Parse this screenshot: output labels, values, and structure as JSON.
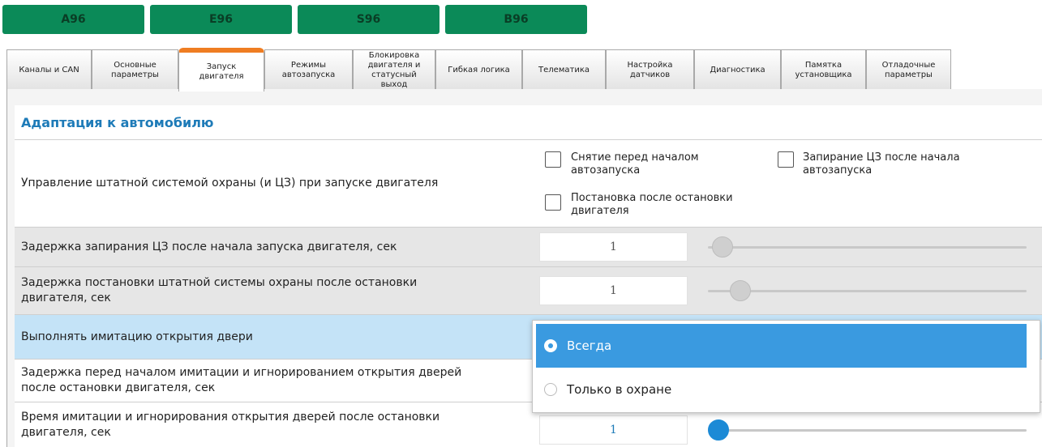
{
  "models": [
    "A96",
    "E96",
    "S96",
    "B96"
  ],
  "tabs": [
    {
      "label": "Каналы и CAN",
      "active": false
    },
    {
      "label": "Основные\nпараметры",
      "active": false
    },
    {
      "label": "Запуск\nдвигателя",
      "active": true
    },
    {
      "label": "Режимы\nавтозапуска",
      "active": false
    },
    {
      "label": "Блокировка\nдвигателя и\nстатусный\nвыход",
      "active": false
    },
    {
      "label": "Гибкая логика",
      "active": false
    },
    {
      "label": "Телематика",
      "active": false
    },
    {
      "label": "Настройка\nдатчиков",
      "active": false
    },
    {
      "label": "Диагностика",
      "active": false
    },
    {
      "label": "Памятка\nустановщика",
      "active": false
    },
    {
      "label": "Отладочные\nпараметры",
      "active": false
    }
  ],
  "section": {
    "title": "Адаптация к автомобилю"
  },
  "rows": {
    "alarm_control": {
      "label": "Управление штатной системой охраны (и ЦЗ) при запуске двигателя",
      "checkbox_disarm": "Снятие перед началом\nавтозапуска",
      "checkbox_lock": "Запирание ЦЗ после начала\nавтозапуска",
      "checkbox_arm": "Постановка после остановки\nдвигателя"
    },
    "lock_delay": {
      "label": "Задержка запирания ЦЗ после начала запуска двигателя, сек",
      "value": "1",
      "slider_value": 1
    },
    "arm_delay": {
      "label": "Задержка постановки штатной системы охраны после остановки\nдвигателя, сек",
      "value": "1",
      "slider_value": 1
    },
    "door_imitation": {
      "label": "Выполнять имитацию открытия двери"
    },
    "imitation_delay": {
      "label": "Задержка перед началом имитации и игнорированием открытия дверей\nпосле остановки двигателя, сек"
    },
    "imitation_time": {
      "label": "Время имитации и игнорирования открытия дверей после остановки\nдвигателя, сек",
      "value": "1",
      "slider_value": 1
    }
  },
  "dropdown": {
    "options": [
      "Всегда",
      "Только в охране"
    ],
    "selected": "Всегда"
  },
  "colors": {
    "model_button": "#0b8a58",
    "active_tab": "#ef7d22",
    "accent": "#1e7bb8",
    "selected_option": "#3a9ae0"
  }
}
